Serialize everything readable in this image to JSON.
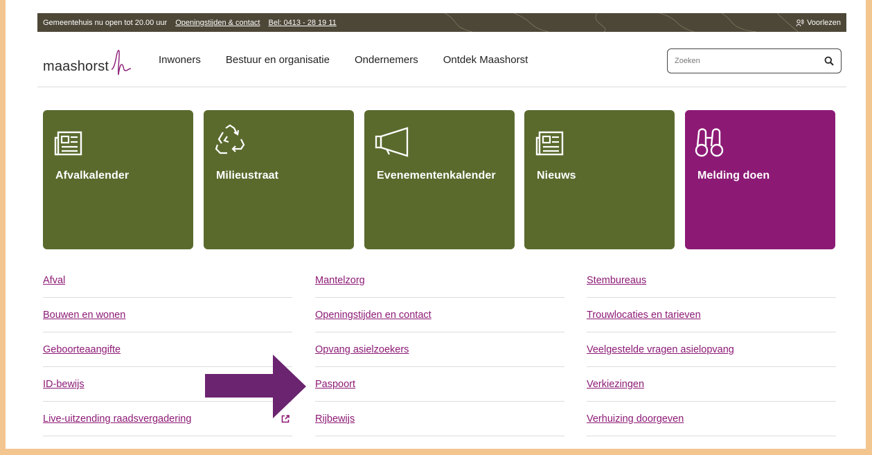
{
  "topbar": {
    "status": "Gemeentehuis nu open tot 20.00 uur",
    "hours_link": "Openingstijden & contact",
    "phone_link": "Bel: 0413 - 28 19 11",
    "read_aloud": "Voorlezen"
  },
  "logo": {
    "text": "maashorst"
  },
  "nav": [
    "Inwoners",
    "Bestuur en organisatie",
    "Ondernemers",
    "Ontdek Maashorst"
  ],
  "search": {
    "placeholder": "Zoeken",
    "icon": "search-icon"
  },
  "tiles": [
    {
      "label": "Afvalkalender",
      "icon": "newspaper-icon",
      "color": "#5a6a2d"
    },
    {
      "label": "Milieustraat",
      "icon": "recycle-icon",
      "color": "#5a6a2d"
    },
    {
      "label": "Evenementenkalender",
      "icon": "megaphone-icon",
      "color": "#5a6a2d"
    },
    {
      "label": "Nieuws",
      "icon": "newspaper-icon",
      "color": "#5a6a2d"
    },
    {
      "label": "Melding doen",
      "icon": "binoculars-icon",
      "color": "#8c1a75"
    }
  ],
  "links": {
    "col1": [
      "Afval",
      "Bouwen en wonen",
      "Geboorteaangifte",
      "ID-bewijs",
      "Live-uitzending raadsvergadering"
    ],
    "col2": [
      "Mantelzorg",
      "Openingstijden en contact",
      "Opvang asielzoekers",
      "Paspoort",
      "Rijbewijs"
    ],
    "col3": [
      "Stembureaus",
      "Trouwlocaties en tarieven",
      "Veelgestelde vragen asielopvang",
      "Verkiezingen",
      "Verhuizing doorgeven"
    ]
  },
  "colors": {
    "accent": "#8c1a75",
    "tile_green": "#5a6a2d",
    "topbar": "#4d4738",
    "background": "#f3c58f"
  }
}
